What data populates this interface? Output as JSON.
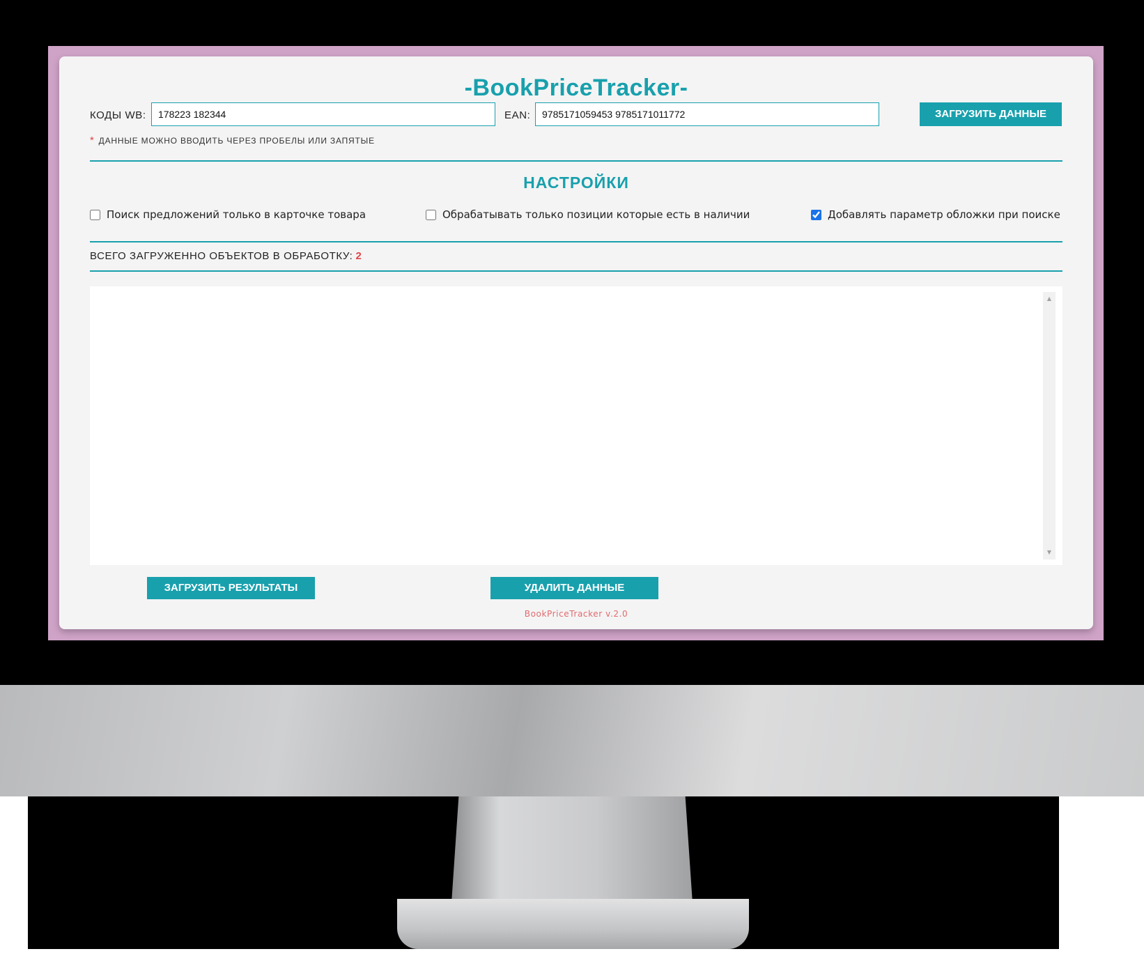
{
  "app": {
    "title": "-BookPriceTracker-",
    "version": "BookPriceTracker v.2.0"
  },
  "inputs": {
    "wb_label": "КОДЫ WB:",
    "wb_value": "178223 182344",
    "ean_label": "EAN:",
    "ean_value": "9785171059453 9785171011772",
    "load_button": "ЗАГРУЗИТЬ ДАННЫЕ",
    "hint_star": "*",
    "hint": "ДАННЫЕ МОЖНО ВВОДИТЬ ЧЕРЕЗ ПРОБЕЛЫ ИЛИ ЗАПЯТЫЕ"
  },
  "settings": {
    "title": "НАСТРОЙКИ",
    "options": [
      {
        "label": "Поиск предложений только в карточке товара",
        "checked": false
      },
      {
        "label": "Обрабатывать только позиции которые есть в наличии",
        "checked": false
      },
      {
        "label": "Добавлять параметр обложки при поиске",
        "checked": true
      }
    ]
  },
  "status": {
    "count_label": "ВСЕГО ЗАГРУЖЕННО ОБЪЕКТОВ В ОБРАБОТКУ:",
    "count_value": "2"
  },
  "actions": {
    "download_results": "ЗАГРУЗИТЬ РЕЗУЛЬТАТЫ",
    "delete_data": "УДАЛИТЬ ДАННЫЕ"
  },
  "icons": {
    "scroll_up": "scroll-up-arrow-icon",
    "scroll_down": "scroll-down-arrow-icon"
  },
  "colors": {
    "accent": "#18a0ad",
    "highlight": "#e0454a",
    "frame": "#cfa3c7"
  }
}
